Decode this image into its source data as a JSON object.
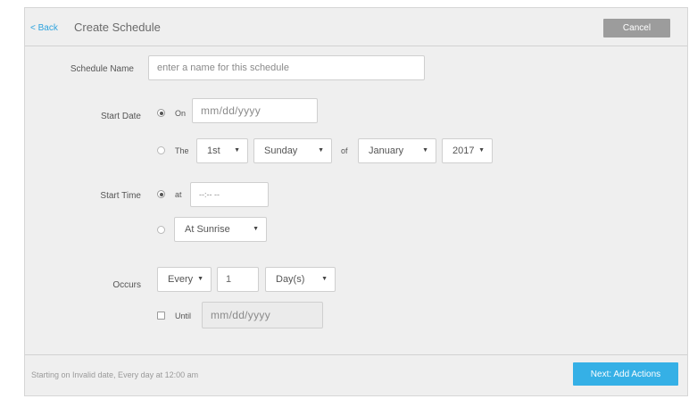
{
  "header": {
    "back_label": "< Back",
    "title": "Create Schedule",
    "cancel_label": "Cancel"
  },
  "schedule_name": {
    "label": "Schedule Name",
    "placeholder": "enter a name for this schedule"
  },
  "start_date": {
    "label": "Start Date",
    "on_label": "On",
    "on_selected": true,
    "date_placeholder": "mm/dd/yyyy",
    "the_label": "The",
    "ordinal": "1st",
    "weekday": "Sunday",
    "of_label": "of",
    "month": "January",
    "year": "2017"
  },
  "start_time": {
    "label": "Start Time",
    "at_label": "at",
    "at_selected": true,
    "time_placeholder": "--:-- --",
    "alternate_option": "At Sunrise"
  },
  "occurs": {
    "label": "Occurs",
    "frequency": "Every",
    "interval": "1",
    "unit": "Day(s)",
    "until_label": "Until",
    "until_checked": false,
    "until_placeholder": "mm/dd/yyyy"
  },
  "footer": {
    "summary": "Starting on Invalid date, Every day at 12:00 am",
    "next_label": "Next: Add Actions"
  },
  "colors": {
    "accent": "#2ea3de",
    "primary_button": "#35b0e6",
    "cancel_button": "#9c9c9c"
  }
}
